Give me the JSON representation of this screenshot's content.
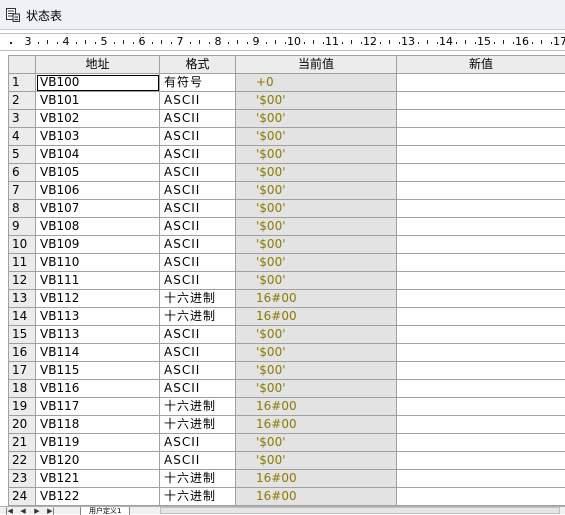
{
  "window": {
    "title": "状态表",
    "icon": "status-table-icon"
  },
  "ruler": {
    "labels": [
      "3",
      "4",
      "5",
      "6",
      "7",
      "8",
      "9",
      "10",
      "11",
      "12",
      "13",
      "14",
      "15",
      "16",
      "17"
    ]
  },
  "table": {
    "headers": {
      "address": "地址",
      "format": "格式",
      "current": "当前值",
      "new": "新值"
    },
    "rows": [
      {
        "n": "1",
        "addr": "VB100",
        "fmt": "有符号",
        "cur": "+0"
      },
      {
        "n": "2",
        "addr": "VB101",
        "fmt": "ASCII",
        "cur": "'$00'"
      },
      {
        "n": "3",
        "addr": "VB102",
        "fmt": "ASCII",
        "cur": "'$00'"
      },
      {
        "n": "4",
        "addr": "VB103",
        "fmt": "ASCII",
        "cur": "'$00'"
      },
      {
        "n": "5",
        "addr": "VB104",
        "fmt": "ASCII",
        "cur": "'$00'"
      },
      {
        "n": "6",
        "addr": "VB105",
        "fmt": "ASCII",
        "cur": "'$00'"
      },
      {
        "n": "7",
        "addr": "VB106",
        "fmt": "ASCII",
        "cur": "'$00'"
      },
      {
        "n": "8",
        "addr": "VB107",
        "fmt": "ASCII",
        "cur": "'$00'"
      },
      {
        "n": "9",
        "addr": "VB108",
        "fmt": "ASCII",
        "cur": "'$00'"
      },
      {
        "n": "10",
        "addr": "VB109",
        "fmt": "ASCII",
        "cur": "'$00'"
      },
      {
        "n": "11",
        "addr": "VB110",
        "fmt": "ASCII",
        "cur": "'$00'"
      },
      {
        "n": "12",
        "addr": "VB111",
        "fmt": "ASCII",
        "cur": "'$00'"
      },
      {
        "n": "13",
        "addr": "VB112",
        "fmt": "十六进制",
        "cur": "16#00"
      },
      {
        "n": "14",
        "addr": "VB113",
        "fmt": "十六进制",
        "cur": "16#00"
      },
      {
        "n": "15",
        "addr": "VB113",
        "fmt": "ASCII",
        "cur": "'$00'"
      },
      {
        "n": "16",
        "addr": "VB114",
        "fmt": "ASCII",
        "cur": "'$00'"
      },
      {
        "n": "17",
        "addr": "VB115",
        "fmt": "ASCII",
        "cur": "'$00'"
      },
      {
        "n": "18",
        "addr": "VB116",
        "fmt": "ASCII",
        "cur": "'$00'"
      },
      {
        "n": "19",
        "addr": "VB117",
        "fmt": "十六进制",
        "cur": "16#00"
      },
      {
        "n": "20",
        "addr": "VB118",
        "fmt": "十六进制",
        "cur": "16#00"
      },
      {
        "n": "21",
        "addr": "VB119",
        "fmt": "ASCII",
        "cur": "'$00'"
      },
      {
        "n": "22",
        "addr": "VB120",
        "fmt": "ASCII",
        "cur": "'$00'"
      },
      {
        "n": "23",
        "addr": "VB121",
        "fmt": "十六进制",
        "cur": "16#00"
      },
      {
        "n": "24",
        "addr": "VB122",
        "fmt": "十六进制",
        "cur": "16#00"
      }
    ]
  },
  "footer": {
    "sheet_tab": "用户定义1"
  },
  "colors": {
    "current_value_text": "#8a7a00",
    "current_value_bg": "#e3e3e3",
    "header_bg": "#ececec"
  }
}
